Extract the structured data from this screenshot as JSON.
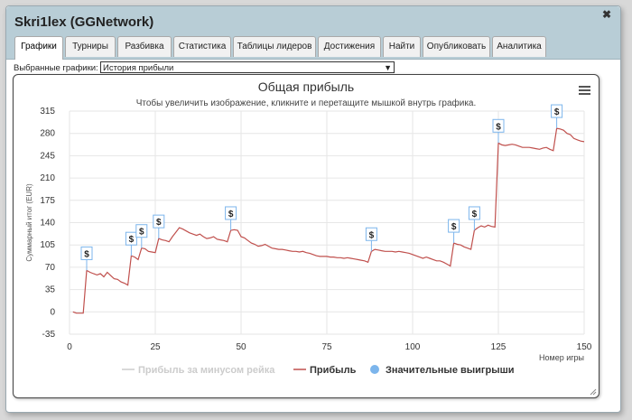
{
  "window": {
    "title": "Skri1lex (GGNetwork)",
    "close_icon": "close-icon"
  },
  "tabs": [
    {
      "label": "Графики",
      "active": true
    },
    {
      "label": "Турниры",
      "active": false
    },
    {
      "label": "Разбивка",
      "active": false
    },
    {
      "label": "Статистика",
      "active": false
    },
    {
      "label": "Таблицы лидеров",
      "active": false
    },
    {
      "label": "Достижения",
      "active": false
    },
    {
      "label": "Найти",
      "active": false
    },
    {
      "label": "Опубликовать",
      "active": false
    },
    {
      "label": "Аналитика",
      "active": false
    }
  ],
  "selector": {
    "label": "Выбранные графики:",
    "selected": "История прибыли"
  },
  "chart_data": {
    "type": "line",
    "title": "Общая прибыль",
    "subtitle": "Чтобы увеличить изображение, кликните и перетащите мышкой внутрь графика.",
    "xlabel": "Номер игры",
    "ylabel": "Суммарный итог (EUR)",
    "xlim": [
      0,
      150
    ],
    "ylim": [
      -35,
      315
    ],
    "xticks": [
      0,
      25,
      50,
      75,
      100,
      125,
      150
    ],
    "yticks": [
      -35,
      0,
      35,
      70,
      105,
      140,
      175,
      210,
      245,
      280,
      315
    ],
    "grid": true,
    "legend_position": "bottom",
    "legend": [
      {
        "label": "Прибыль за минусом рейка",
        "color": "#cccccc",
        "kind": "line",
        "hidden": true
      },
      {
        "label": "Прибыль",
        "color": "#c0504d",
        "kind": "line",
        "hidden": false
      },
      {
        "label": "Значительные выигрыши",
        "color": "#7cb5ec",
        "kind": "circle",
        "hidden": false
      }
    ],
    "series": [
      {
        "name": "Прибыль",
        "color": "#c0504d",
        "points": [
          [
            1,
            0
          ],
          [
            2,
            -2
          ],
          [
            3,
            -2
          ],
          [
            4,
            -2
          ],
          [
            5,
            65
          ],
          [
            6,
            62
          ],
          [
            7,
            60
          ],
          [
            8,
            58
          ],
          [
            9,
            60
          ],
          [
            10,
            55
          ],
          [
            11,
            62
          ],
          [
            12,
            57
          ],
          [
            13,
            52
          ],
          [
            14,
            51
          ],
          [
            15,
            47
          ],
          [
            16,
            45
          ],
          [
            17,
            42
          ],
          [
            18,
            88
          ],
          [
            19,
            86
          ],
          [
            20,
            82
          ],
          [
            21,
            100
          ],
          [
            22,
            99
          ],
          [
            23,
            95
          ],
          [
            24,
            94
          ],
          [
            25,
            93
          ],
          [
            26,
            115
          ],
          [
            27,
            113
          ],
          [
            28,
            112
          ],
          [
            29,
            110
          ],
          [
            30,
            118
          ],
          [
            31,
            125
          ],
          [
            32,
            132
          ],
          [
            33,
            130
          ],
          [
            34,
            127
          ],
          [
            35,
            124
          ],
          [
            36,
            122
          ],
          [
            37,
            120
          ],
          [
            38,
            122
          ],
          [
            39,
            118
          ],
          [
            40,
            115
          ],
          [
            41,
            116
          ],
          [
            42,
            118
          ],
          [
            43,
            114
          ],
          [
            44,
            113
          ],
          [
            45,
            112
          ],
          [
            46,
            110
          ],
          [
            47,
            128
          ],
          [
            48,
            129
          ],
          [
            49,
            128
          ],
          [
            50,
            118
          ],
          [
            51,
            116
          ],
          [
            52,
            112
          ],
          [
            53,
            108
          ],
          [
            54,
            106
          ],
          [
            55,
            103
          ],
          [
            56,
            104
          ],
          [
            57,
            106
          ],
          [
            58,
            103
          ],
          [
            59,
            100
          ],
          [
            60,
            99
          ],
          [
            61,
            98
          ],
          [
            62,
            98
          ],
          [
            63,
            97
          ],
          [
            64,
            96
          ],
          [
            65,
            95
          ],
          [
            66,
            95
          ],
          [
            67,
            94
          ],
          [
            68,
            95
          ],
          [
            69,
            93
          ],
          [
            70,
            92
          ],
          [
            71,
            90
          ],
          [
            72,
            88
          ],
          [
            73,
            87
          ],
          [
            74,
            87
          ],
          [
            75,
            87
          ],
          [
            76,
            86
          ],
          [
            77,
            86
          ],
          [
            78,
            85
          ],
          [
            79,
            85
          ],
          [
            80,
            84
          ],
          [
            81,
            85
          ],
          [
            82,
            84
          ],
          [
            83,
            83
          ],
          [
            84,
            82
          ],
          [
            85,
            81
          ],
          [
            86,
            80
          ],
          [
            87,
            78
          ],
          [
            88,
            95
          ],
          [
            89,
            98
          ],
          [
            90,
            97
          ],
          [
            91,
            96
          ],
          [
            92,
            95
          ],
          [
            93,
            95
          ],
          [
            94,
            95
          ],
          [
            95,
            94
          ],
          [
            96,
            95
          ],
          [
            97,
            94
          ],
          [
            98,
            93
          ],
          [
            99,
            92
          ],
          [
            100,
            90
          ],
          [
            101,
            88
          ],
          [
            102,
            86
          ],
          [
            103,
            84
          ],
          [
            104,
            86
          ],
          [
            105,
            84
          ],
          [
            106,
            82
          ],
          [
            107,
            80
          ],
          [
            108,
            80
          ],
          [
            109,
            78
          ],
          [
            110,
            75
          ],
          [
            111,
            72
          ],
          [
            112,
            108
          ],
          [
            113,
            106
          ],
          [
            114,
            105
          ],
          [
            115,
            102
          ],
          [
            116,
            100
          ],
          [
            117,
            98
          ],
          [
            118,
            128
          ],
          [
            119,
            132
          ],
          [
            120,
            135
          ],
          [
            121,
            133
          ],
          [
            122,
            136
          ],
          [
            123,
            134
          ],
          [
            124,
            133
          ],
          [
            125,
            265
          ],
          [
            126,
            262
          ],
          [
            127,
            261
          ],
          [
            128,
            262
          ],
          [
            129,
            263
          ],
          [
            130,
            262
          ],
          [
            131,
            260
          ],
          [
            132,
            258
          ],
          [
            133,
            258
          ],
          [
            134,
            258
          ],
          [
            135,
            257
          ],
          [
            136,
            256
          ],
          [
            137,
            255
          ],
          [
            138,
            257
          ],
          [
            139,
            258
          ],
          [
            140,
            255
          ],
          [
            141,
            253
          ],
          [
            142,
            288
          ],
          [
            143,
            287
          ],
          [
            144,
            285
          ],
          [
            145,
            280
          ],
          [
            146,
            278
          ],
          [
            147,
            272
          ],
          [
            148,
            270
          ],
          [
            149,
            268
          ],
          [
            150,
            267
          ]
        ]
      }
    ],
    "markers": [
      {
        "x": 5,
        "y": 65,
        "label": "$"
      },
      {
        "x": 18,
        "y": 88,
        "label": "$"
      },
      {
        "x": 21,
        "y": 100,
        "label": "$"
      },
      {
        "x": 26,
        "y": 115,
        "label": "$"
      },
      {
        "x": 47,
        "y": 128,
        "label": "$"
      },
      {
        "x": 88,
        "y": 95,
        "label": "$"
      },
      {
        "x": 112,
        "y": 108,
        "label": "$"
      },
      {
        "x": 118,
        "y": 128,
        "label": "$"
      },
      {
        "x": 125,
        "y": 265,
        "label": "$"
      },
      {
        "x": 142,
        "y": 288,
        "label": "$"
      }
    ]
  }
}
